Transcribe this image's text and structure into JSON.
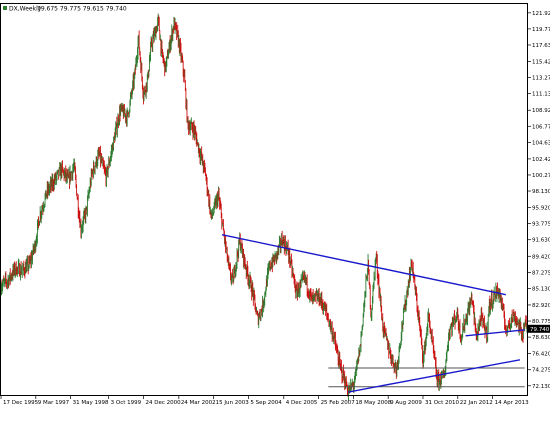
{
  "header": {
    "symbol_label": "DX,Weekly",
    "ohlc_text": "79.675 79.775 79.615 79.740"
  },
  "chart_data": {
    "type": "candlestick",
    "symbol": "DX",
    "timeframe": "Weekly",
    "ohlc_last": {
      "open": 79.675,
      "high": 79.775,
      "low": 79.615,
      "close": 79.74
    },
    "current_price_label": "79.740",
    "colors": {
      "up": "#2e7d32",
      "down": "#cc1111",
      "trendline": "#1a1acc",
      "level": "#555555",
      "frame": "#000000"
    },
    "grid": false,
    "yaxis": {
      "position": "right",
      "ylim": [
        70.9,
        123.1
      ],
      "ticks": [
        121.92,
        119.775,
        117.63,
        115.42,
        113.275,
        111.13,
        108.92,
        106.775,
        104.63,
        102.42,
        100.275,
        98.13,
        95.92,
        93.775,
        91.63,
        89.42,
        87.275,
        85.13,
        82.92,
        80.775,
        78.63,
        76.42,
        74.275,
        72.13
      ],
      "tick_labels": [
        "121.920",
        "119.775",
        "117.630",
        "115.420",
        "113.275",
        "111.130",
        "108.920",
        "106.775",
        "104.630",
        "102.420",
        "100.275",
        "98.130",
        "95.920",
        "93.775",
        "91.630",
        "89.420",
        "87.275",
        "85.130",
        "82.920",
        "80.775",
        "78.630",
        "76.420",
        "74.275",
        "72.130"
      ]
    },
    "xaxis": {
      "range": [
        "1995-12-17",
        "2014-07-01"
      ],
      "ticks": [
        "1995-12-17",
        "1997-03-09",
        "1998-05-31",
        "1999-10-03",
        "2000-12-24",
        "2002-03-24",
        "2003-06-15",
        "2004-09-05",
        "2005-12-04",
        "2007-02-25",
        "2008-05-18",
        "2009-08-09",
        "2010-10-31",
        "2012-01-22",
        "2013-04-14"
      ],
      "tick_labels": [
        "17 Dec 1995",
        "9 Mar 1997",
        "31 May 1998",
        "3 Oct 1999",
        "24 Dec 2000",
        "24 Mar 2002",
        "15 Jun 2003",
        "5 Sep 2004",
        "4 Dec 2005",
        "25 Feb 2007",
        "18 May 2008",
        "9 Aug 2009",
        "31 Oct 2010",
        "22 Jan 2012",
        "14 Apr 2013"
      ]
    },
    "price_path": [
      [
        "1995-12-17",
        85.5
      ],
      [
        "1996-03-15",
        86.2
      ],
      [
        "1996-06-20",
        87.8
      ],
      [
        "1996-09-20",
        87.5
      ],
      [
        "1996-12-20",
        88.4
      ],
      [
        "1997-03-01",
        91.0
      ],
      [
        "1997-05-01",
        95.0
      ],
      [
        "1997-08-01",
        98.0
      ],
      [
        "1997-11-01",
        99.5
      ],
      [
        "1998-02-01",
        101.0
      ],
      [
        "1998-05-01",
        99.5
      ],
      [
        "1998-07-15",
        101.5
      ],
      [
        "1998-09-01",
        96.5
      ],
      [
        "1998-10-10",
        93.0
      ],
      [
        "1998-12-20",
        95.5
      ],
      [
        "1999-03-01",
        100.5
      ],
      [
        "1999-06-01",
        103.0
      ],
      [
        "1999-09-01",
        100.0
      ],
      [
        "1999-12-01",
        104.5
      ],
      [
        "2000-03-01",
        109.0
      ],
      [
        "2000-06-01",
        108.0
      ],
      [
        "2000-09-01",
        113.5
      ],
      [
        "2000-10-20",
        118.5
      ],
      [
        "2000-12-24",
        111.0
      ],
      [
        "2001-02-15",
        113.0
      ],
      [
        "2001-04-01",
        117.5
      ],
      [
        "2001-07-05",
        120.8
      ],
      [
        "2001-08-15",
        116.5
      ],
      [
        "2001-10-01",
        114.5
      ],
      [
        "2002-01-20",
        120.5
      ],
      [
        "2002-03-24",
        118.0
      ],
      [
        "2002-06-01",
        113.5
      ],
      [
        "2002-07-15",
        107.0
      ],
      [
        "2002-10-01",
        106.5
      ],
      [
        "2002-12-01",
        104.0
      ],
      [
        "2003-03-01",
        100.5
      ],
      [
        "2003-05-15",
        94.5
      ],
      [
        "2003-08-15",
        97.5
      ],
      [
        "2003-10-15",
        93.0
      ],
      [
        "2004-01-01",
        87.5
      ],
      [
        "2004-02-15",
        86.0
      ],
      [
        "2004-05-15",
        91.5
      ],
      [
        "2004-08-01",
        88.0
      ],
      [
        "2004-11-01",
        84.5
      ],
      [
        "2004-12-31",
        81.0
      ],
      [
        "2005-03-01",
        82.5
      ],
      [
        "2005-06-01",
        88.0
      ],
      [
        "2005-09-01",
        89.5
      ],
      [
        "2005-11-15",
        91.7
      ],
      [
        "2006-02-01",
        90.0
      ],
      [
        "2006-05-15",
        84.5
      ],
      [
        "2006-09-01",
        86.5
      ],
      [
        "2006-12-01",
        83.5
      ],
      [
        "2007-03-01",
        84.0
      ],
      [
        "2007-06-01",
        82.0
      ],
      [
        "2007-09-01",
        79.0
      ],
      [
        "2007-11-25",
        74.8
      ],
      [
        "2008-03-16",
        71.3
      ],
      [
        "2008-06-01",
        72.6
      ],
      [
        "2008-08-15",
        77.5
      ],
      [
        "2008-11-21",
        88.5
      ],
      [
        "2009-01-01",
        81.5
      ],
      [
        "2009-03-04",
        89.6
      ],
      [
        "2009-06-01",
        80.0
      ],
      [
        "2009-09-01",
        76.5
      ],
      [
        "2009-11-25",
        74.2
      ],
      [
        "2010-02-01",
        80.0
      ],
      [
        "2010-06-07",
        88.7
      ],
      [
        "2010-09-01",
        81.5
      ],
      [
        "2010-11-04",
        75.6
      ],
      [
        "2011-01-10",
        81.5
      ],
      [
        "2011-05-04",
        72.7
      ],
      [
        "2011-08-01",
        73.5
      ],
      [
        "2011-10-04",
        79.5
      ],
      [
        "2012-01-13",
        81.7
      ],
      [
        "2012-03-01",
        78.7
      ],
      [
        "2012-07-24",
        84.0
      ],
      [
        "2012-09-14",
        78.6
      ],
      [
        "2012-11-15",
        81.2
      ],
      [
        "2013-02-01",
        79.0
      ],
      [
        "2013-03-01",
        82.8
      ],
      [
        "2013-05-22",
        84.5
      ],
      [
        "2013-07-09",
        84.7
      ],
      [
        "2013-10-17",
        79.0
      ],
      [
        "2013-11-01",
        80.5
      ],
      [
        "2014-01-20",
        81.5
      ],
      [
        "2014-05-06",
        78.9
      ],
      [
        "2014-06-01",
        80.5
      ],
      [
        "2014-07-01",
        79.74
      ]
    ],
    "trendlines": [
      {
        "name": "upper-trendline",
        "from": [
          "2003-10-01",
          92.3
        ],
        "to": [
          "2013-10-01",
          84.3
        ]
      },
      {
        "name": "lower-rising-trendline",
        "from": [
          "2008-03-16",
          71.3
        ],
        "to": [
          "2014-04-01",
          75.6
        ]
      },
      {
        "name": "short-support-line",
        "from": [
          "2012-05-01",
          78.8
        ],
        "to": [
          "2014-06-01",
          79.6
        ]
      }
    ],
    "horizontal_levels": [
      {
        "name": "level-74-5",
        "value": 74.5,
        "from": "2007-07-01",
        "to": "2014-06-01"
      },
      {
        "name": "level-72-0",
        "value": 72.0,
        "from": "2007-07-01",
        "to": "2014-06-01"
      }
    ]
  }
}
